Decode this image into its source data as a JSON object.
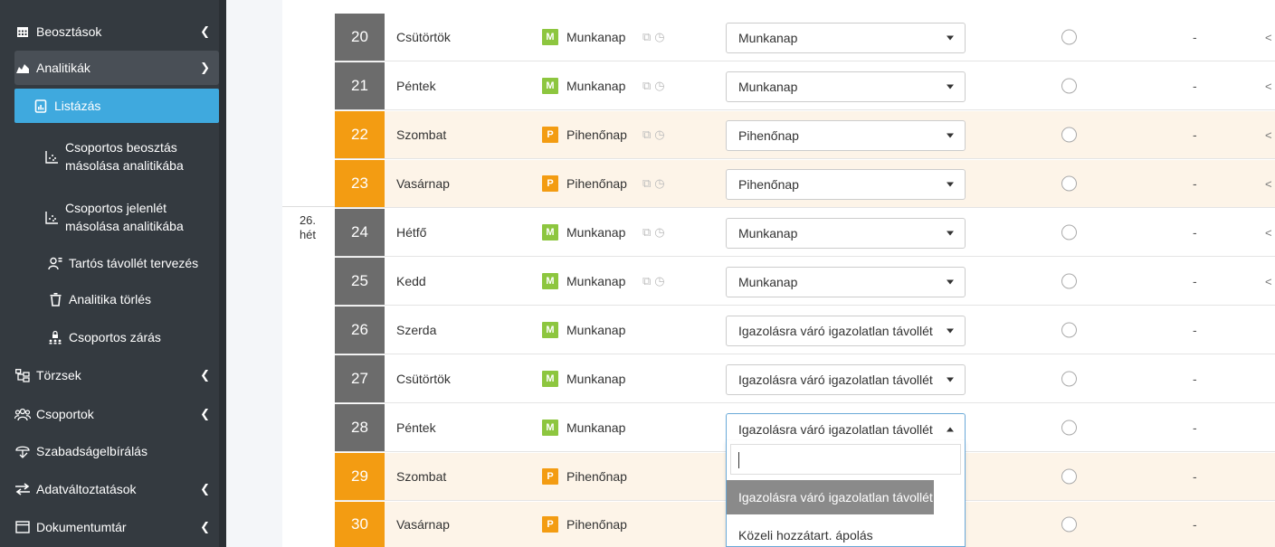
{
  "sidebar": {
    "items": [
      {
        "label": "Beosztások",
        "icon": "calendar-icon"
      },
      {
        "label": "Analitikák",
        "icon": "chart-area-icon"
      },
      {
        "label": "Listázás",
        "icon": "file-chart-icon"
      },
      {
        "label1": "Csoportos beosztás",
        "label2": "másolása analitikába",
        "icon": "scatter-chart-icon"
      },
      {
        "label1": "Csoportos jelenlét",
        "label2": "másolása analitikába",
        "icon": "scatter-chart-icon"
      },
      {
        "label": "Tartós távollét tervezés",
        "icon": "user-plan-icon"
      },
      {
        "label": "Analitika törlés",
        "icon": "trash-icon"
      },
      {
        "label": "Csoportos zárás",
        "icon": "group-lock-icon"
      },
      {
        "label": "Törzsek",
        "icon": "sitemap-icon"
      },
      {
        "label": "Csoportok",
        "icon": "users-icon"
      },
      {
        "label": "Szabadságelbírálás",
        "icon": "vacation-icon"
      },
      {
        "label": "Adatváltoztatások",
        "icon": "exchange-icon"
      },
      {
        "label": "Dokumentumtár",
        "icon": "folder-icon"
      }
    ]
  },
  "week": {
    "label1": "26.",
    "label2": "hét"
  },
  "rows": [
    {
      "num": "20",
      "day": "Csütörtök",
      "badge": "M",
      "type": "Munkanap",
      "select": "Munkanap"
    },
    {
      "num": "21",
      "day": "Péntek",
      "badge": "M",
      "type": "Munkanap",
      "select": "Munkanap"
    },
    {
      "num": "22",
      "day": "Szombat",
      "badge": "P",
      "type": "Pihenőnap",
      "select": "Pihenőnap"
    },
    {
      "num": "23",
      "day": "Vasárnap",
      "badge": "P",
      "type": "Pihenőnap",
      "select": "Pihenőnap"
    },
    {
      "num": "24",
      "day": "Hétfő",
      "badge": "M",
      "type": "Munkanap",
      "select": "Munkanap"
    },
    {
      "num": "25",
      "day": "Kedd",
      "badge": "M",
      "type": "Munkanap",
      "select": "Munkanap"
    },
    {
      "num": "26",
      "day": "Szerda",
      "badge": "M",
      "type": "Munkanap",
      "select": "Igazolásra váró igazolatlan távollét"
    },
    {
      "num": "27",
      "day": "Csütörtök",
      "badge": "M",
      "type": "Munkanap",
      "select": "Igazolásra váró igazolatlan távollét"
    },
    {
      "num": "28",
      "day": "Péntek",
      "badge": "M",
      "type": "Munkanap",
      "select": "Igazolásra váró igazolatlan távollét"
    },
    {
      "num": "29",
      "day": "Szombat",
      "badge": "P",
      "type": "Pihenőnap",
      "select": ""
    },
    {
      "num": "30",
      "day": "Vasárnap",
      "badge": "P",
      "type": "Pihenőnap",
      "select": ""
    }
  ],
  "dash": "-",
  "arrow": "<",
  "dropdown": {
    "search": "",
    "options": [
      "Igazolásra váró igazolatlan távollét",
      "Közeli hozzátart. ápolás"
    ]
  },
  "colors": {
    "sidebar": "#343a40",
    "active": "#3fa9de",
    "workday_badge": "#8dc63f",
    "restday": "#f39c12",
    "daynum_grey": "#6c6c6c"
  }
}
